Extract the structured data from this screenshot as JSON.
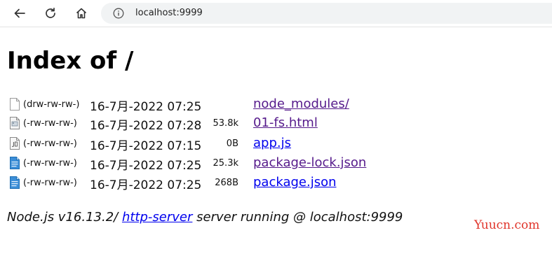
{
  "browser": {
    "url": "localhost:9999",
    "icons": {
      "back": "back-arrow-icon",
      "reload": "reload-icon",
      "home": "home-icon",
      "site_info": "info-icon"
    }
  },
  "page": {
    "title": "Index of /",
    "entries": [
      {
        "permissions": "(drw-rw-rw-)",
        "date": "16-7月-2022 07:25",
        "size": "",
        "name": "node_modules/",
        "icon": "folder-icon",
        "visited": true
      },
      {
        "permissions": "(-rw-rw-rw-)",
        "date": "16-7月-2022 07:28",
        "size": "53.8k",
        "name": "01-fs.html",
        "icon": "html-file-icon",
        "visited": true
      },
      {
        "permissions": "(-rw-rw-rw-)",
        "date": "16-7月-2022 07:15",
        "size": "0B",
        "name": "app.js",
        "icon": "js-file-icon",
        "visited": false
      },
      {
        "permissions": "(-rw-rw-rw-)",
        "date": "16-7月-2022 07:25",
        "size": "25.3k",
        "name": "package-lock.json",
        "icon": "json-file-icon",
        "visited": true
      },
      {
        "permissions": "(-rw-rw-rw-)",
        "date": "16-7月-2022 07:25",
        "size": "268B",
        "name": "package.json",
        "icon": "json-file-icon",
        "visited": false
      }
    ],
    "footer": {
      "prefix": "Node.js v16.13.2/ ",
      "link_text": "http-server",
      "suffix": " server running @ localhost:9999"
    }
  },
  "watermark": "Yuucn.com",
  "colors": {
    "link_visited": "#551a8b",
    "link_unvisited": "#0000ee",
    "watermark": "#e0342a"
  }
}
